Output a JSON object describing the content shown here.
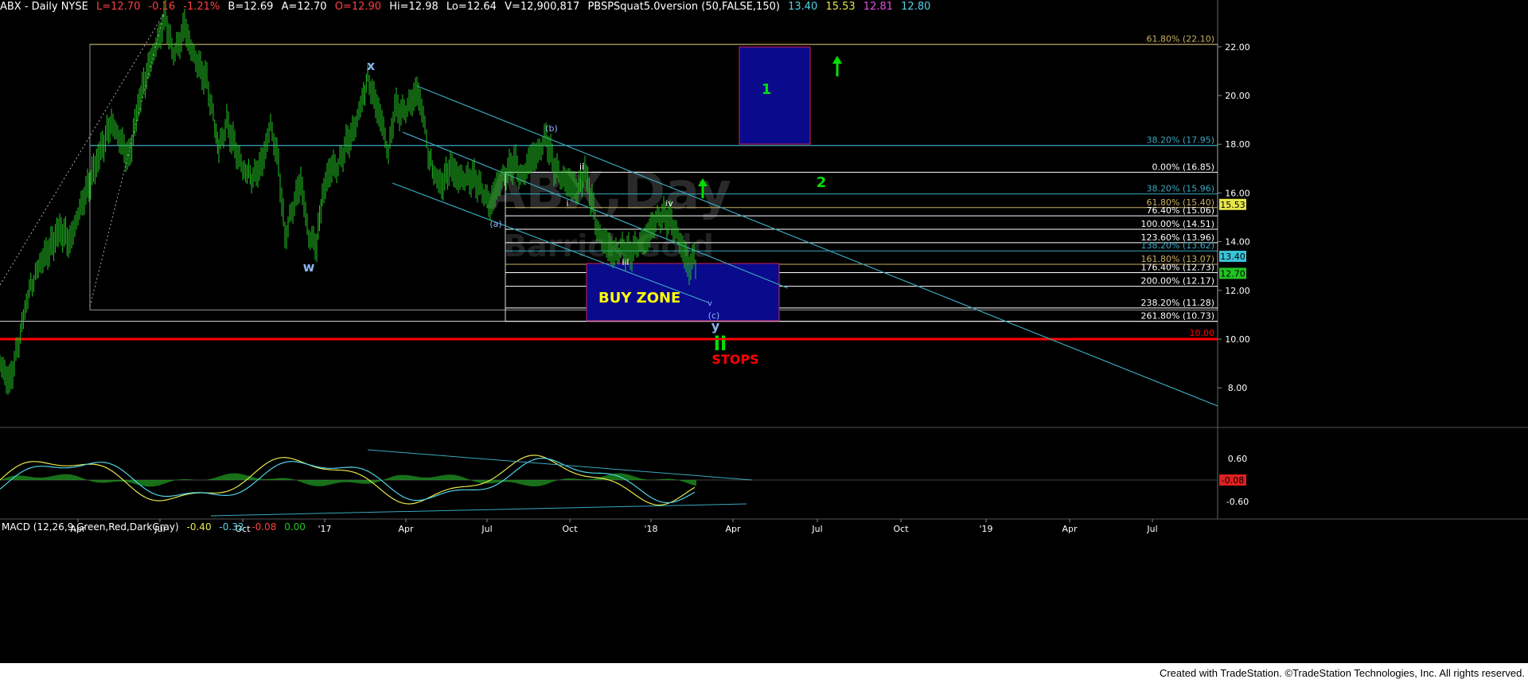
{
  "header": {
    "symbol": "ABX - Daily  NYSE",
    "last": "L=12.70",
    "change": "-0.16",
    "change_pct": "-1.21%",
    "bid": "B=12.69",
    "ask": "A=12.70",
    "open": "O=12.90",
    "high": "Hi=12.98",
    "low": "Lo=12.64",
    "volume": "V=12,900,817",
    "indicator": "PBSPSquat5.0version (50,FALSE,150)",
    "ind_v1": "13.40",
    "ind_v2": "15.53",
    "ind_v3": "12.81",
    "ind_v4": "12.80"
  },
  "macd_header": {
    "label": "MACD (12,26,9,Green,Red,DarkGray)",
    "v1": "-0.40",
    "v2": "-0.32",
    "v3": "-0.08",
    "v4": "0.00"
  },
  "footer": {
    "credit": "Created with TradeStation. ©TradeStation Technologies, Inc. All rights reserved."
  },
  "colors": {
    "price": "#22c322",
    "fib": "#ffffff",
    "cyan": "#3aa8c0",
    "green": "#00e000",
    "red": "#ff0000",
    "yellow": "#ffff00",
    "box": "#0a0a8c"
  },
  "watermark": {
    "line1": "ABX,Day",
    "line2": "Barrick Gold"
  },
  "annotations": {
    "buy_zone": "BUY ZONE",
    "stops": "STOPS",
    "w": "w",
    "x": "x",
    "y": "y",
    "a": "(a)",
    "b": "(b)",
    "c": "(c)",
    "i": "i",
    "ii_small": "ii",
    "iii": "iii",
    "iv": "iv",
    "v": "v",
    "ii_big": "ii",
    "one": "1",
    "two": "2"
  },
  "chart_data": {
    "type": "line",
    "title": "ABX - Daily NYSE",
    "x_ticks": [
      "Apr",
      "Jul",
      "Oct",
      "'17",
      "Apr",
      "Jul",
      "Oct",
      "'18",
      "Apr",
      "Jul",
      "Oct",
      "'19",
      "Apr",
      "Jul"
    ],
    "y_ticks": [
      "22.00",
      "20.00",
      "18.00",
      "16.00",
      "14.00",
      "12.00",
      "10.00",
      "8.00"
    ],
    "ylim": [
      7.0,
      23.5
    ],
    "series": [
      {
        "points": [
          [
            0,
            9.0
          ],
          [
            12,
            8.2
          ],
          [
            22,
            9.6
          ],
          [
            35,
            11.8
          ],
          [
            50,
            13.1
          ],
          [
            62,
            13.7
          ],
          [
            75,
            14.5
          ],
          [
            88,
            14.0
          ],
          [
            100,
            15.3
          ],
          [
            110,
            16.2
          ],
          [
            125,
            17.6
          ],
          [
            140,
            18.9
          ],
          [
            152,
            18.1
          ],
          [
            162,
            17.4
          ],
          [
            175,
            19.8
          ],
          [
            188,
            21.3
          ],
          [
            200,
            22.4
          ],
          [
            208,
            23.3
          ],
          [
            216,
            21.8
          ],
          [
            224,
            22.0
          ],
          [
            232,
            22.9
          ],
          [
            240,
            21.9
          ],
          [
            250,
            21.2
          ],
          [
            260,
            20.6
          ],
          [
            268,
            19.1
          ],
          [
            275,
            17.8
          ],
          [
            285,
            18.9
          ],
          [
            295,
            17.9
          ],
          [
            305,
            17.0
          ],
          [
            318,
            16.6
          ],
          [
            330,
            17.3
          ],
          [
            340,
            18.8
          ],
          [
            350,
            17.2
          ],
          [
            358,
            14.2
          ],
          [
            368,
            15.4
          ],
          [
            378,
            16.5
          ],
          [
            388,
            14.2
          ],
          [
            398,
            13.9
          ],
          [
            405,
            15.9
          ],
          [
            415,
            17.0
          ],
          [
            425,
            17.1
          ],
          [
            435,
            18.0
          ],
          [
            445,
            18.6
          ],
          [
            455,
            19.8
          ],
          [
            462,
            20.7
          ],
          [
            472,
            19.7
          ],
          [
            480,
            18.9
          ],
          [
            488,
            17.6
          ],
          [
            496,
            19.5
          ],
          [
            506,
            19.3
          ],
          [
            516,
            19.7
          ],
          [
            524,
            20.2
          ],
          [
            532,
            19.2
          ],
          [
            538,
            17.6
          ],
          [
            545,
            16.8
          ],
          [
            555,
            16.3
          ],
          [
            566,
            17.1
          ],
          [
            576,
            16.6
          ],
          [
            586,
            16.6
          ],
          [
            596,
            16.6
          ],
          [
            606,
            16.1
          ],
          [
            616,
            15.5
          ],
          [
            626,
            16.4
          ],
          [
            636,
            16.8
          ],
          [
            646,
            17.3
          ],
          [
            656,
            16.6
          ],
          [
            666,
            17.4
          ],
          [
            676,
            17.6
          ],
          [
            686,
            18.3
          ],
          [
            696,
            17.1
          ],
          [
            706,
            16.6
          ],
          [
            716,
            16.4
          ],
          [
            726,
            16.1
          ],
          [
            735,
            16.9
          ],
          [
            744,
            15.6
          ],
          [
            752,
            14.3
          ],
          [
            762,
            13.9
          ],
          [
            772,
            13.5
          ],
          [
            782,
            13.7
          ],
          [
            792,
            13.5
          ],
          [
            802,
            13.9
          ],
          [
            812,
            14.1
          ],
          [
            822,
            14.8
          ],
          [
            832,
            15.1
          ],
          [
            842,
            14.9
          ],
          [
            852,
            14.2
          ],
          [
            860,
            13.5
          ],
          [
            866,
            12.9
          ],
          [
            872,
            13.4
          ],
          [
            876,
            12.7
          ]
        ]
      }
    ],
    "fib_levels": [
      {
        "label": "61.80% (22.10)",
        "value": 22.1
      },
      {
        "label": "38.20% (17.95)",
        "value": 17.95
      },
      {
        "label": "0.00% (16.85)",
        "value": 16.85
      },
      {
        "label": "38.20% (15.96)",
        "value": 15.96
      },
      {
        "label": "61.80% (15.40)",
        "value": 15.4
      },
      {
        "label": "76.40% (15.06)",
        "value": 15.06
      },
      {
        "label": "100.00% (14.51)",
        "value": 14.51
      },
      {
        "label": "123.60% (13.96)",
        "value": 13.96
      },
      {
        "label": "138.20% (13.62)",
        "value": 13.62
      },
      {
        "label": "161.80% (13.07)",
        "value": 13.07
      },
      {
        "label": "176.40% (12.73)",
        "value": 12.73
      },
      {
        "label": "200.00% (12.17)",
        "value": 12.17
      },
      {
        "label": "238.20% (11.28)",
        "value": 11.28
      },
      {
        "label": "261.80% (10.73)",
        "value": 10.73
      }
    ],
    "stop_level": {
      "label": "10.00",
      "value": 10.0
    },
    "last_price": "12.70",
    "ind_price_1": "15.53",
    "ind_price_2": "13.40",
    "macd_ticks": [
      "0.60",
      "-0.60"
    ],
    "macd_last": "-0.08"
  }
}
